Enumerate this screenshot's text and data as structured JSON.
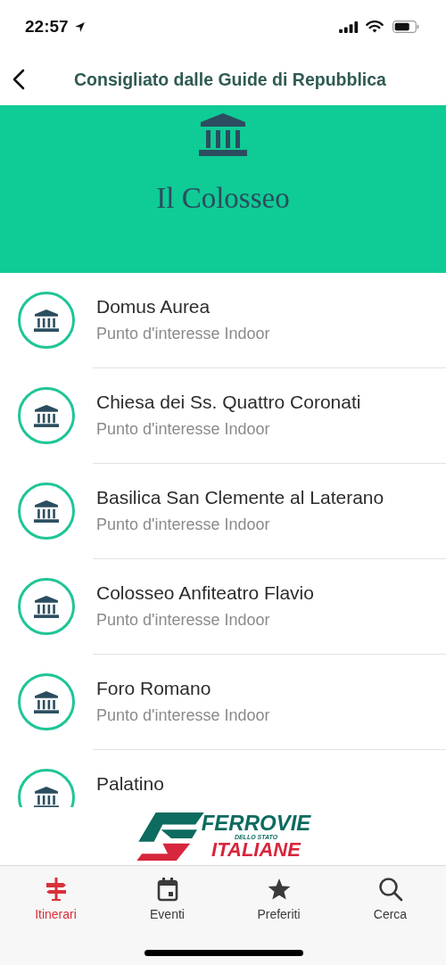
{
  "status_bar": {
    "time": "22:57"
  },
  "nav": {
    "title": "Consigliato dalle Guide di Repubblica"
  },
  "banner": {
    "title": "Il Colosseo"
  },
  "places": [
    {
      "name": "Domus Aurea",
      "category": "Punto d'interesse Indoor"
    },
    {
      "name": "Chiesa dei Ss. Quattro Coronati",
      "category": "Punto d'interesse Indoor"
    },
    {
      "name": "Basilica San Clemente al Laterano",
      "category": "Punto d'interesse Indoor"
    },
    {
      "name": "Colosseo Anfiteatro Flavio",
      "category": "Punto d'interesse Indoor"
    },
    {
      "name": "Foro Romano",
      "category": "Punto d'interesse Indoor"
    },
    {
      "name": "Palatino"
    }
  ],
  "sponsor": {
    "line_1": "FERROVIE",
    "line_2": "DELLO STATO",
    "line_3": "ITALIANE"
  },
  "tabs": [
    {
      "label": "Itinerari",
      "kind": "signpost",
      "selected": true
    },
    {
      "label": "Eventi",
      "kind": "calendar",
      "selected": false
    },
    {
      "label": "Preferiti",
      "kind": "star",
      "selected": false
    },
    {
      "label": "Cerca",
      "kind": "search",
      "selected": false
    }
  ]
}
